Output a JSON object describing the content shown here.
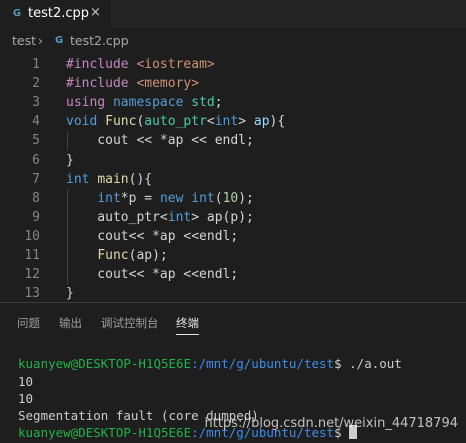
{
  "tab": {
    "icon": "G",
    "label": "test2.cpp",
    "close": "×"
  },
  "breadcrumb": {
    "folder": "test",
    "separator": "›",
    "icon": "G",
    "file": "test2.cpp"
  },
  "code_lines": [
    {
      "n": "1",
      "tokens": [
        [
          "#include ",
          "#c586c0"
        ],
        [
          "<iostream>",
          "#ce9178"
        ]
      ]
    },
    {
      "n": "2",
      "tokens": [
        [
          "#include ",
          "#c586c0"
        ],
        [
          "<memory>",
          "#ce9178"
        ]
      ]
    },
    {
      "n": "3",
      "tokens": [
        [
          "using ",
          "#c586c0"
        ],
        [
          "namespace ",
          "#569cd6"
        ],
        [
          "std",
          "#4ec9b0"
        ],
        [
          ";",
          "#d4d4d4"
        ]
      ]
    },
    {
      "n": "4",
      "tokens": [
        [
          "void ",
          "#569cd6"
        ],
        [
          "Func",
          "#dcdcaa"
        ],
        [
          "(",
          "#d4d4d4"
        ],
        [
          "auto_ptr",
          "#4ec9b0"
        ],
        [
          "<",
          "#d4d4d4"
        ],
        [
          "int",
          "#569cd6"
        ],
        [
          "> ",
          "#d4d4d4"
        ],
        [
          "ap",
          "#9cdcfe"
        ],
        [
          "){",
          "#d4d4d4"
        ]
      ]
    },
    {
      "n": "5",
      "tokens": [
        [
          "    cout << *ap << endl;",
          "#d4d4d4"
        ]
      ]
    },
    {
      "n": "6",
      "tokens": [
        [
          "}",
          "#d4d4d4"
        ]
      ]
    },
    {
      "n": "7",
      "tokens": [
        [
          "int ",
          "#569cd6"
        ],
        [
          "main",
          "#dcdcaa"
        ],
        [
          "(){",
          "#d4d4d4"
        ]
      ]
    },
    {
      "n": "8",
      "tokens": [
        [
          "    ",
          "#d4d4d4"
        ],
        [
          "int",
          "#569cd6"
        ],
        [
          "*p = ",
          "#d4d4d4"
        ],
        [
          "new ",
          "#569cd6"
        ],
        [
          "int",
          "#569cd6"
        ],
        [
          "(",
          "#d4d4d4"
        ],
        [
          "10",
          "#b5cea8"
        ],
        [
          ");",
          "#d4d4d4"
        ]
      ]
    },
    {
      "n": "9",
      "tokens": [
        [
          "    auto_ptr",
          "#d4d4d4"
        ],
        [
          "<",
          "#d4d4d4"
        ],
        [
          "int",
          "#569cd6"
        ],
        [
          "> ap(p);",
          "#d4d4d4"
        ]
      ]
    },
    {
      "n": "10",
      "tokens": [
        [
          "    cout<< *ap <<endl;",
          "#d4d4d4"
        ]
      ]
    },
    {
      "n": "11",
      "tokens": [
        [
          "    ",
          "#d4d4d4"
        ],
        [
          "Func",
          "#dcdcaa"
        ],
        [
          "(ap);",
          "#d4d4d4"
        ]
      ]
    },
    {
      "n": "12",
      "tokens": [
        [
          "    cout<< *ap <<endl;",
          "#d4d4d4"
        ]
      ]
    },
    {
      "n": "13",
      "tokens": [
        [
          "}",
          "#d4d4d4"
        ]
      ]
    }
  ],
  "panel": {
    "tabs": [
      "问题",
      "输出",
      "调试控制台",
      "终端"
    ],
    "active_tab": "终端"
  },
  "terminal": {
    "prompt1": {
      "user": "kuanyew@DESKTOP-H1Q5E6E",
      "path": ":/mnt/g/ubuntu/test",
      "command": "$ ./a.out"
    },
    "output": [
      "10",
      "10",
      "Segmentation fault (core dumped)"
    ],
    "prompt2": {
      "user": "kuanyew@DESKTOP-H1Q5E6E",
      "path": ":/mnt/g/ubuntu/test",
      "command": "$ "
    }
  },
  "watermark": "https://blog.csdn.net/weixin_44718794",
  "colors": {
    "background": "#1e1e1e",
    "tabbar": "#252526",
    "user": "#22b14c",
    "path": "#3b8eea"
  }
}
